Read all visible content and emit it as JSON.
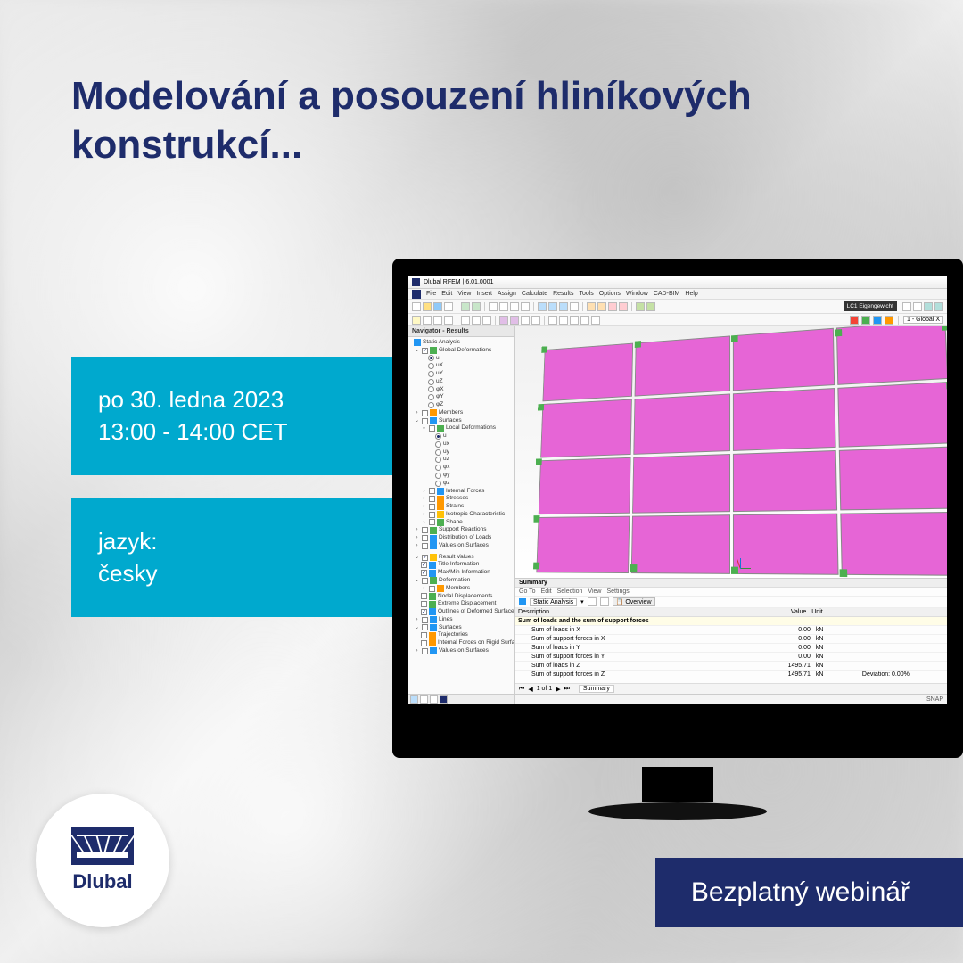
{
  "headline": "Modelování a posouzení hliníkových konstrukcí...",
  "info": {
    "date_line1": "po 30. ledna 2023",
    "date_line2": "13:00 - 14:00 CET",
    "lang_label": "jazyk:",
    "lang_value": "česky"
  },
  "cta": "Bezplatný webinář",
  "brand": "Dlubal",
  "app": {
    "title": "Dlubal RFEM | 6.01.0001",
    "menus": [
      "File",
      "Edit",
      "View",
      "Insert",
      "Assign",
      "Calculate",
      "Results",
      "Tools",
      "Options",
      "Window",
      "CAD-BIM",
      "Help"
    ],
    "lc_label": "LC1",
    "lc_name": "Eigengewicht",
    "view_label": "1 - Global X",
    "navigator_title": "Navigator - Results",
    "static_analysis": "Static Analysis",
    "tree": {
      "global_def": "Global Deformations",
      "u": "u",
      "ux": "uX",
      "uy": "uY",
      "uz": "uZ",
      "phix": "φX",
      "phiy": "φY",
      "phiz": "φZ",
      "members": "Members",
      "surfaces": "Surfaces",
      "local_def": "Local Deformations",
      "lu": "u",
      "lux": "ux",
      "luy": "uy",
      "luz": "uz",
      "lphix": "φx",
      "lphiy": "φy",
      "lphiz": "φz",
      "int_forces": "Internal Forces",
      "stresses": "Stresses",
      "strains": "Strains",
      "iso": "Isotropic Characteristic",
      "shape": "Shape",
      "support": "Support Reactions",
      "distrib": "Distribution of Loads",
      "vals_surf": "Values on Surfaces",
      "result_values": "Result Values",
      "title_info": "Title Information",
      "maxmin": "Max/Min Information",
      "deformation": "Deformation",
      "def_members": "Members",
      "nodal_disp": "Nodal Displacements",
      "extreme_disp": "Extreme Displacement",
      "outlines": "Outlines of Deformed Surfaces",
      "lines": "Lines",
      "surfaces2": "Surfaces",
      "trajectories": "Trajectories",
      "int_forces_rigid": "Internal Forces on Rigid Surfac...",
      "vals_surf2": "Values on Surfaces"
    },
    "summary": {
      "title": "Summary",
      "menus": [
        "Go To",
        "Edit",
        "Selection",
        "View",
        "Settings"
      ],
      "dropdown": "Static Analysis",
      "tab": "Overview",
      "cols": {
        "desc": "Description",
        "value": "Value",
        "unit": "Unit"
      },
      "group": "Sum of loads and the sum of support forces",
      "rows": [
        {
          "desc": "Sum of loads in X",
          "value": "0.00",
          "unit": "kN",
          "extra": ""
        },
        {
          "desc": "Sum of support forces in X",
          "value": "0.00",
          "unit": "kN",
          "extra": ""
        },
        {
          "desc": "Sum of loads in Y",
          "value": "0.00",
          "unit": "kN",
          "extra": ""
        },
        {
          "desc": "Sum of support forces in Y",
          "value": "0.00",
          "unit": "kN",
          "extra": ""
        },
        {
          "desc": "Sum of loads in Z",
          "value": "1495.71",
          "unit": "kN",
          "extra": ""
        },
        {
          "desc": "Sum of support forces in Z",
          "value": "1495.71",
          "unit": "kN",
          "extra": "Deviation: 0.00%"
        }
      ],
      "pager": "1 of 1",
      "pager_tab": "Summary"
    },
    "status_snap": "SNAP"
  }
}
